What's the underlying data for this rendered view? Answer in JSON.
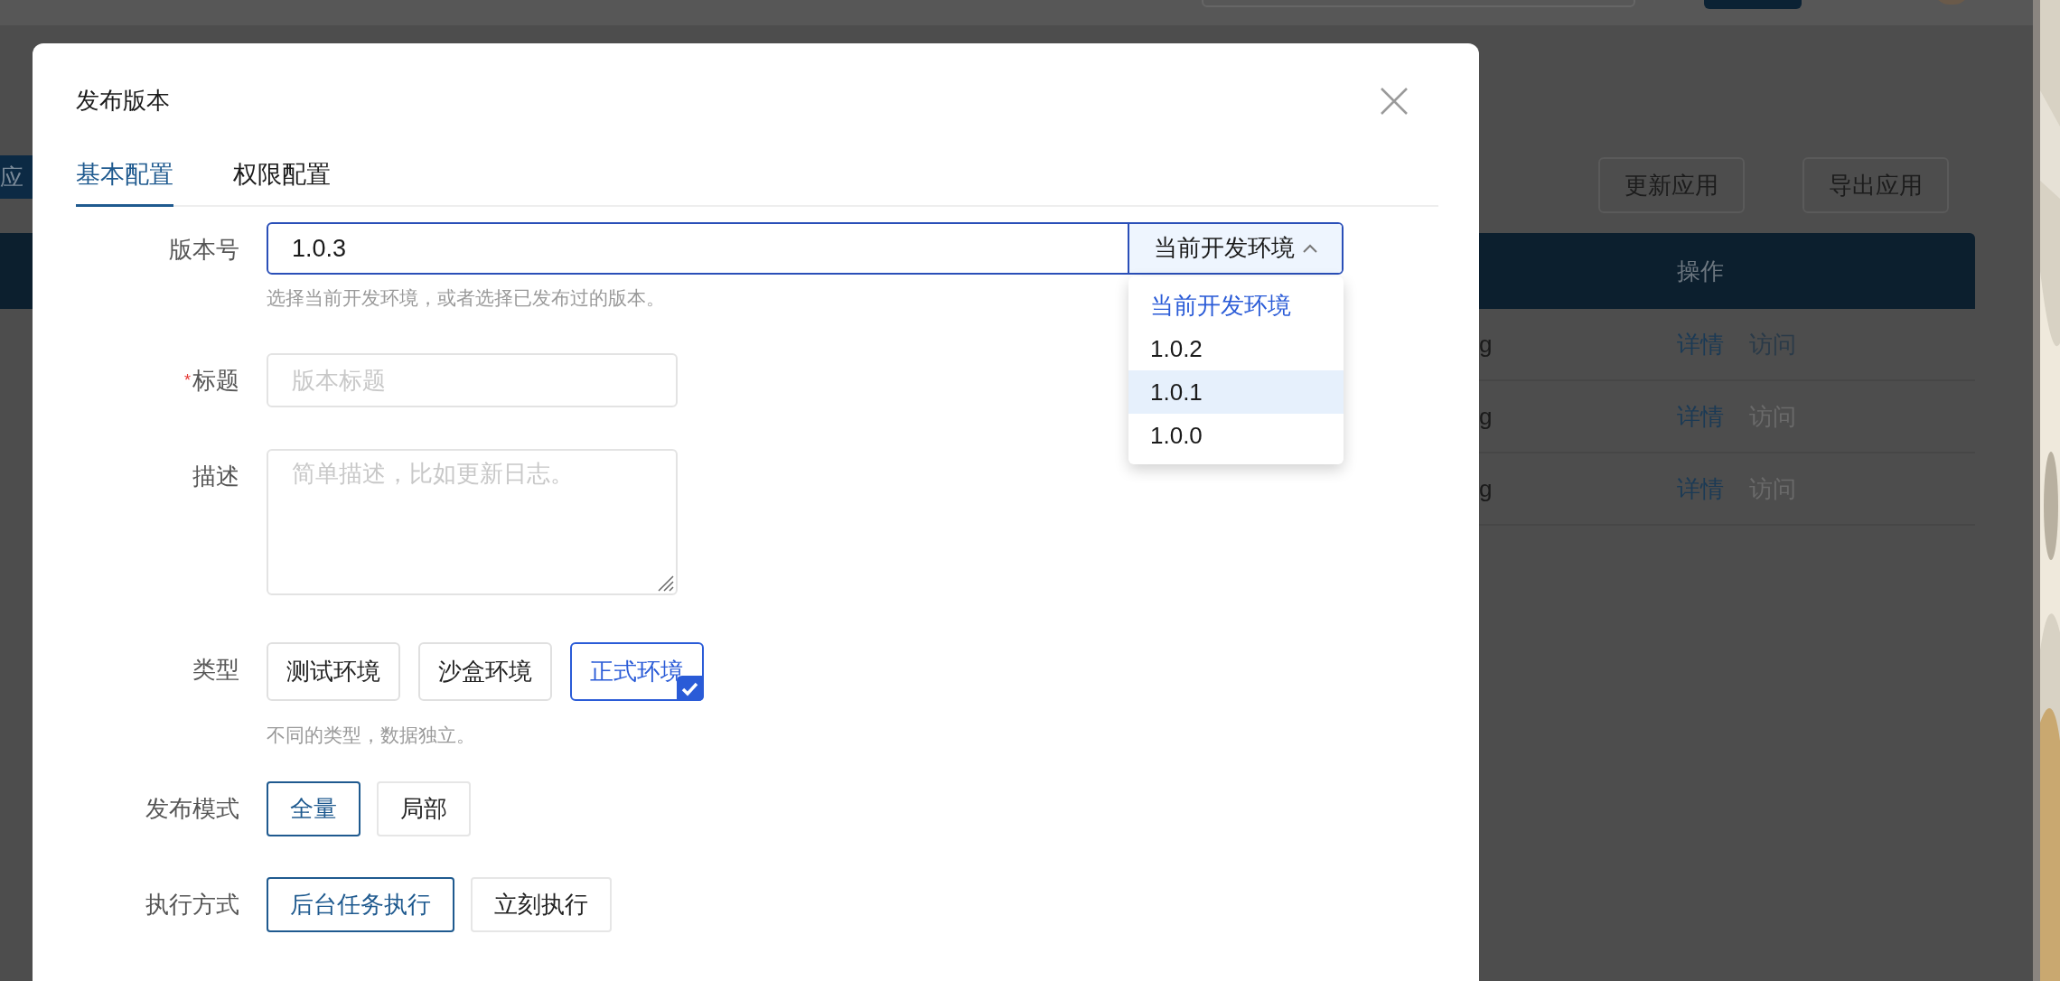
{
  "background": {
    "left_button": "应",
    "toolbar_buttons": [
      "更新应用",
      "导出应用"
    ],
    "table": {
      "columns": [
        "操作"
      ],
      "rows": [
        {
          "column_1": "g",
          "actions": [
            {
              "label": "详情",
              "disabled": false
            },
            {
              "label": "访问",
              "disabled": false
            }
          ]
        },
        {
          "column_1": "g",
          "actions": [
            {
              "label": "详情",
              "disabled": false
            },
            {
              "label": "访问",
              "disabled": true
            }
          ]
        },
        {
          "column_1": "g",
          "actions": [
            {
              "label": "详情",
              "disabled": false
            },
            {
              "label": "访问",
              "disabled": true
            }
          ]
        }
      ]
    }
  },
  "dialog": {
    "title": "发布版本",
    "tabs": [
      {
        "label": "基本配置",
        "selected": true
      },
      {
        "label": "权限配置",
        "selected": false
      }
    ],
    "version": {
      "label": "版本号",
      "value": "1.0.3",
      "addon": "当前开发环境",
      "expanded": true,
      "hint": "选择当前开发环境，或者选择已发布过的版本。",
      "options": [
        {
          "label": "当前开发环境",
          "selected": true,
          "highlighted": false
        },
        {
          "label": "1.0.2",
          "selected": false,
          "highlighted": false
        },
        {
          "label": "1.0.1",
          "selected": false,
          "highlighted": true
        },
        {
          "label": "1.0.0",
          "selected": false,
          "highlighted": false
        }
      ]
    },
    "title_field": {
      "label": "标题",
      "required_mark": "*",
      "placeholder": "版本标题"
    },
    "description": {
      "label": "描述",
      "placeholder": "简单描述，比如更新日志。"
    },
    "groups": [
      {
        "label": "类型",
        "kind": "check",
        "hint": "不同的类型，数据独立。",
        "options": [
          {
            "label": "测试环境",
            "selected": false
          },
          {
            "label": "沙盒环境",
            "selected": false
          },
          {
            "label": "正式环境",
            "selected": true
          }
        ]
      },
      {
        "label": "发布模式",
        "kind": "outline",
        "options": [
          {
            "label": "全量",
            "selected": true
          },
          {
            "label": "局部",
            "selected": false
          }
        ]
      },
      {
        "label": "执行方式",
        "kind": "outline",
        "options": [
          {
            "label": "后台任务执行",
            "selected": true
          },
          {
            "label": "立刻执行",
            "selected": false
          }
        ]
      }
    ]
  }
}
